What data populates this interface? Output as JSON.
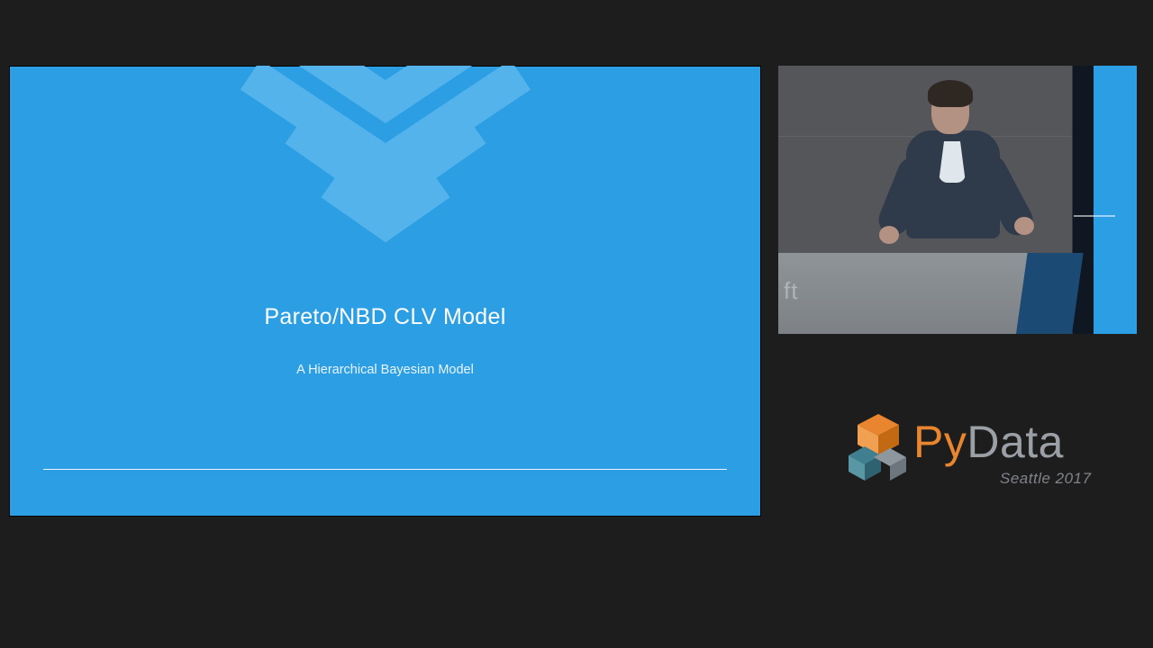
{
  "slide": {
    "title": "Pareto/NBD CLV Model",
    "subtitle": "A Hierarchical Bayesian Model"
  },
  "podium": {
    "logo_fragment": "ft"
  },
  "logo": {
    "part1": "Py",
    "part2": "Data",
    "subtitle": "Seattle 2017"
  },
  "colors": {
    "slide_bg": "#2b9ee4",
    "brand_orange": "#e9852e",
    "brand_teal": "#3f7f8f",
    "brand_gray": "#9aa0a6"
  }
}
